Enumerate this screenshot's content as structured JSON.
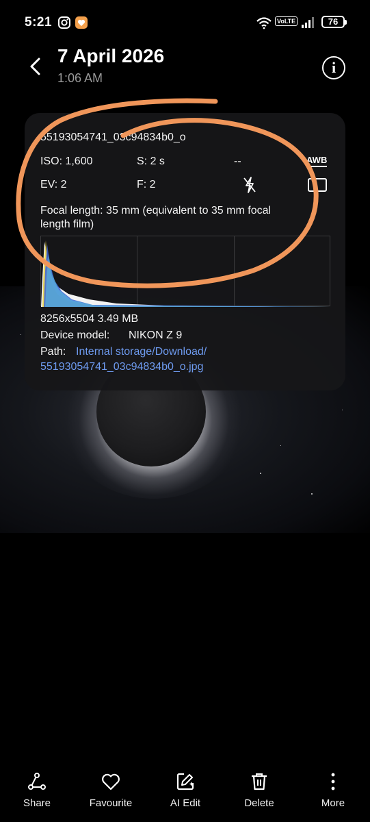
{
  "status_bar": {
    "time": "5:21",
    "network_badge": "VoLTE",
    "battery": "76"
  },
  "header": {
    "title": "7 April 2026",
    "subtitle": "1:06 AM"
  },
  "details": {
    "file_name": "55193054741_03c94834b0_o",
    "iso": "ISO: 1,600",
    "shutter": "S: 2 s",
    "placeholder": "--",
    "awb": "AWB",
    "ev": "EV: 2",
    "aperture": "F: 2",
    "focal_line1": "Focal length: 35 mm (equivalent to 35 mm focal",
    "focal_line2": "length film)",
    "resolution_size": "8256x5504  3.49 MB",
    "device_label": "Device model:",
    "device_value": "NIKON Z 9",
    "path_label": "Path:",
    "path_line1": "Internal storage/Download/",
    "path_line2": "55193054741_03c94834b0_o.jpg"
  },
  "colors": {
    "accent_link": "#6e9bf0",
    "annotation": "#f0965a",
    "panel_bg": "#161618"
  },
  "nav": [
    {
      "label": "Share",
      "icon": "share-icon"
    },
    {
      "label": "Favourite",
      "icon": "heart-icon"
    },
    {
      "label": "AI Edit",
      "icon": "ai-edit-icon"
    },
    {
      "label": "Delete",
      "icon": "trash-icon"
    },
    {
      "label": "More",
      "icon": "more-vertical-icon"
    }
  ]
}
